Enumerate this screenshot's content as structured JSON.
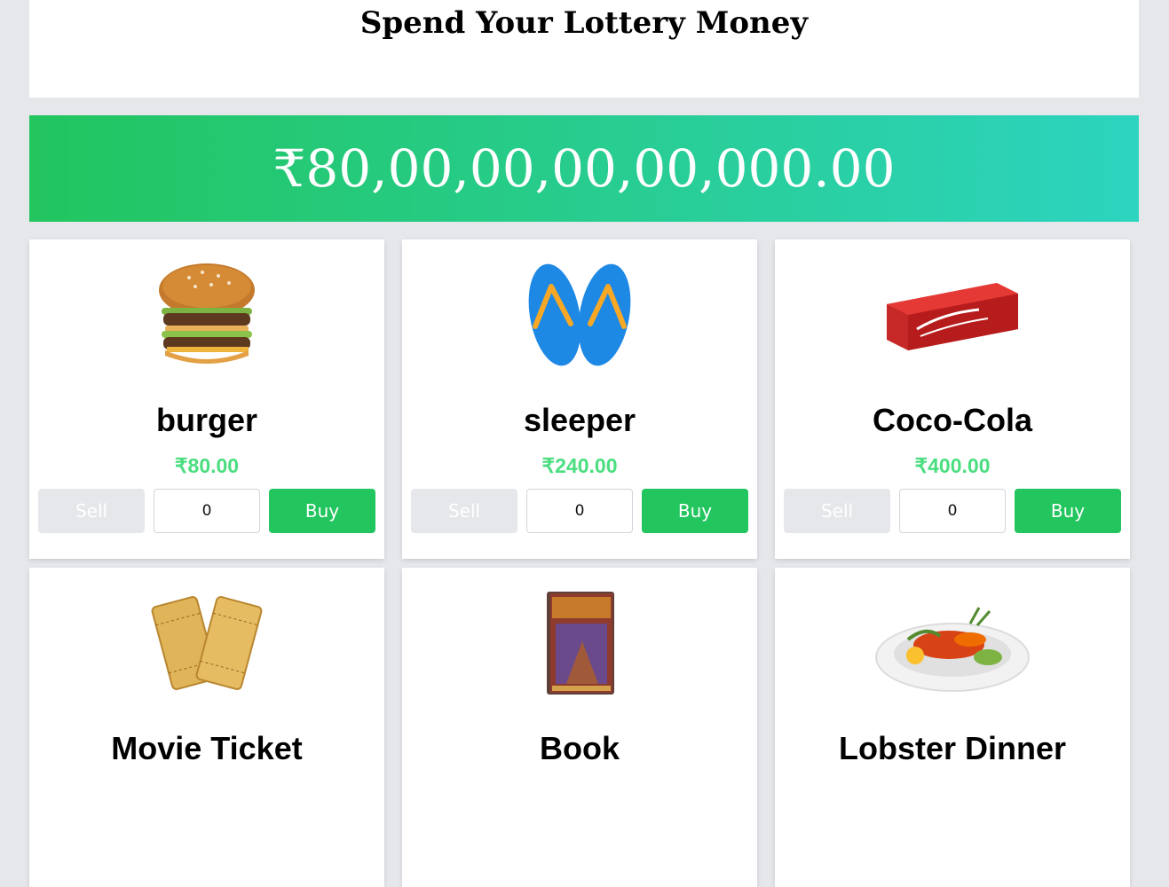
{
  "header": {
    "title": "Spend Your Lottery Money"
  },
  "balance": {
    "amount": "₹80,00,00,00,00,000.00"
  },
  "controls": {
    "sell_label": "Sell",
    "buy_label": "Buy"
  },
  "products": [
    {
      "name": "burger",
      "price": "₹80.00",
      "quantity": "0",
      "icon": "burger-icon"
    },
    {
      "name": "sleeper",
      "price": "₹240.00",
      "quantity": "0",
      "icon": "flip-flops-icon"
    },
    {
      "name": "Coco-Cola",
      "price": "₹400.00",
      "quantity": "0",
      "icon": "coca-cola-pack-icon"
    },
    {
      "name": "Movie Ticket",
      "icon": "movie-ticket-icon"
    },
    {
      "name": "Book",
      "icon": "book-icon"
    },
    {
      "name": "Lobster Dinner",
      "icon": "lobster-dinner-icon"
    }
  ],
  "colors": {
    "accent": "#22c55e",
    "accent_end": "#2dd4bf",
    "price": "#4ade80",
    "background": "#e5e7eb"
  }
}
